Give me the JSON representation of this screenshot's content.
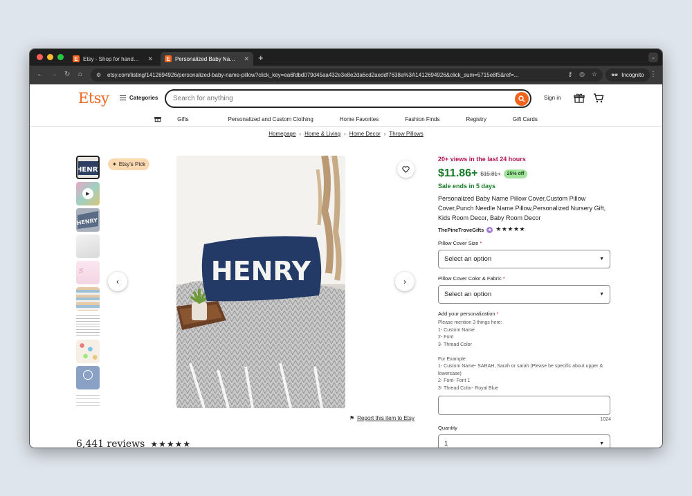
{
  "browser": {
    "tabs": [
      {
        "title": "Etsy - Shop for handmade, vi",
        "active": false
      },
      {
        "title": "Personalized Baby Name Pillo",
        "active": true
      }
    ],
    "url": "etsy.com/listing/1412694926/personalized-baby-name-pillow?click_key=ea6fdbd079d45aa432e3e8e2da6cd2aeddf7638a%3A1412694926&click_sum=5715e8f5&ref=...",
    "incognito_label": "Incognito"
  },
  "header": {
    "logo": "Etsy",
    "categories_label": "Categories",
    "search_placeholder": "Search for anything",
    "sign_in": "Sign in"
  },
  "subnav": [
    "Gifts",
    "Personalized and Custom Clothing",
    "Home Favorites",
    "Fashion Finds",
    "Registry",
    "Gift Cards"
  ],
  "breadcrumbs": [
    "Homepage",
    "Home & Living",
    "Home Decor",
    "Throw Pillows"
  ],
  "gallery": {
    "badge": "Etsy's Pick",
    "main_image_text": "HENRY",
    "report_link": "Report this item to Etsy"
  },
  "reviews": {
    "count_label": "6,441 reviews",
    "stars": "★★★★★"
  },
  "listing": {
    "views": "20+ views in the last 24 hours",
    "price": "$11.86+",
    "original_price": "$15.81+",
    "discount": "25% off",
    "sale_ends": "Sale ends in 5 days",
    "title": "Personalized Baby Name Pillow Cover,Custom Pillow Cover,Punch Needle Name Pillow,Personalized Nursery Gift, Kids Room Decor, Baby Room Decor",
    "shop_name": "ThePineTroveGifts",
    "shop_stars": "★★★★★",
    "size_label": "Pillow Cover Size",
    "size_value": "Select an option",
    "color_label": "Pillow Cover Color & Fabric",
    "color_value": "Select an option",
    "personalization_label": "Add your personalization",
    "personalization_instructions": "Please mention 3 things here:\n1- Custom Name\n2- Font\n3- Thread Color\n\nFor Example:\n1- Custom Name- SARAH, Sarah or sarah (Please be specific about upper & lowercase)\n2- Font- Font 1\n3- Thread Color- Royal Blue",
    "char_count": "1024",
    "quantity_label": "Quantity",
    "quantity_value": "1"
  },
  "colors": {
    "brand_orange": "#f1641e",
    "price_green": "#167b27",
    "views_red": "#b3134e",
    "discount_bg": "#a4e39f",
    "pick_bg": "#fbd9b0"
  }
}
